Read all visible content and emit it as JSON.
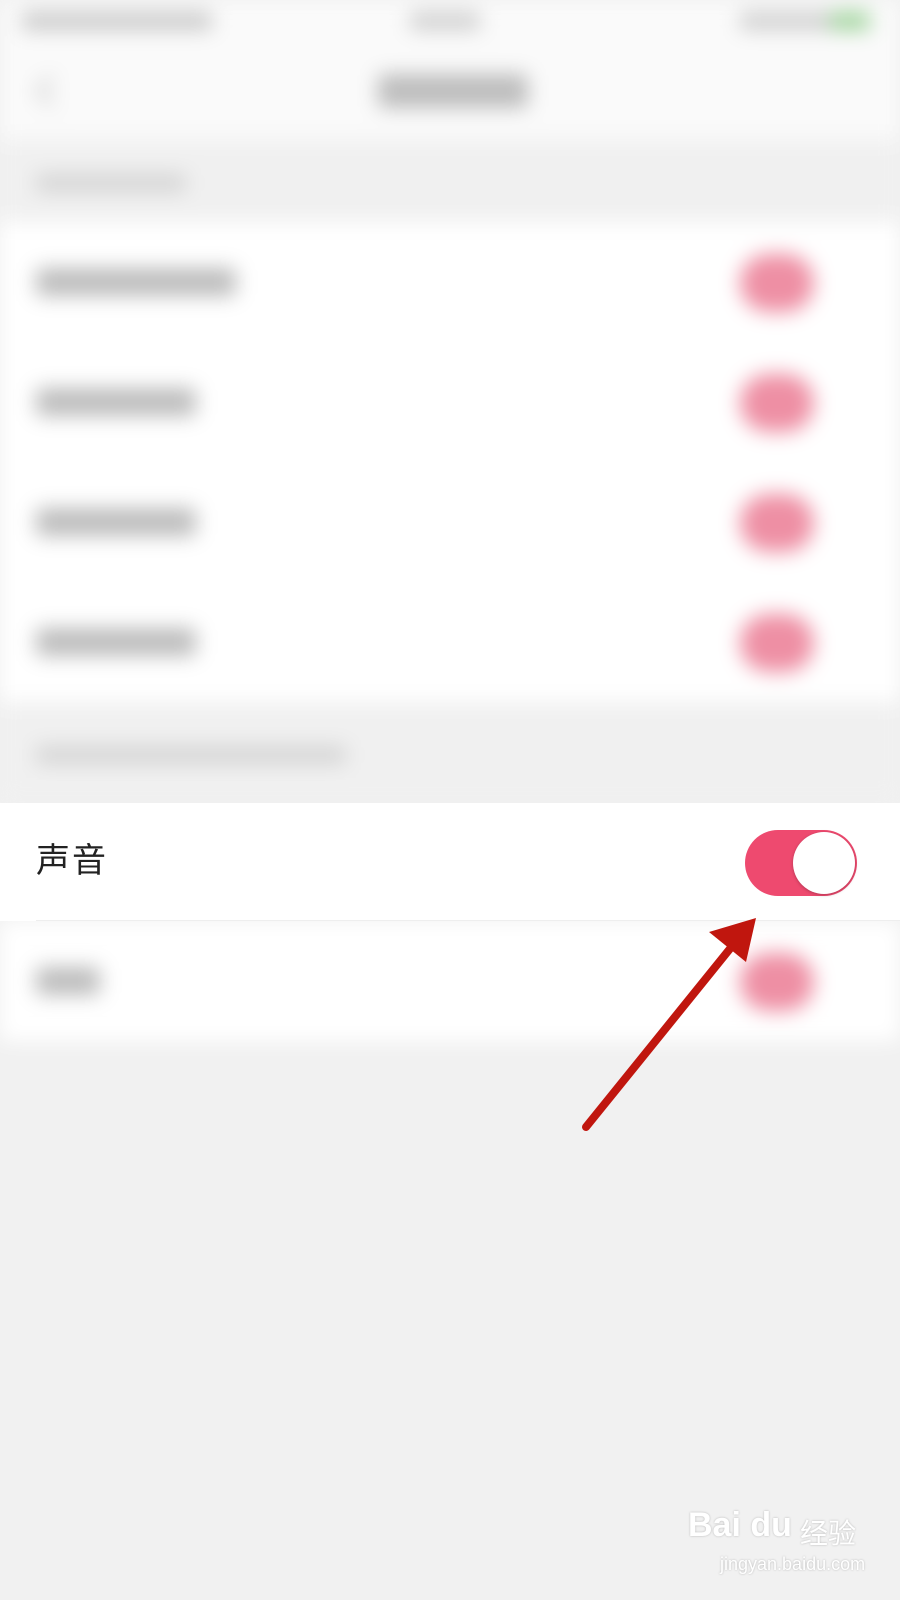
{
  "settings": {
    "sound": {
      "label": "声音",
      "enabled": true,
      "toggle_color": "#ee4a6f"
    }
  },
  "watermark": {
    "logo": "Bai du",
    "name": "经验",
    "url": "jingyan.baidu.com"
  },
  "colors": {
    "accent": "#ee4a6f",
    "annotation_arrow": "#c0160e"
  }
}
